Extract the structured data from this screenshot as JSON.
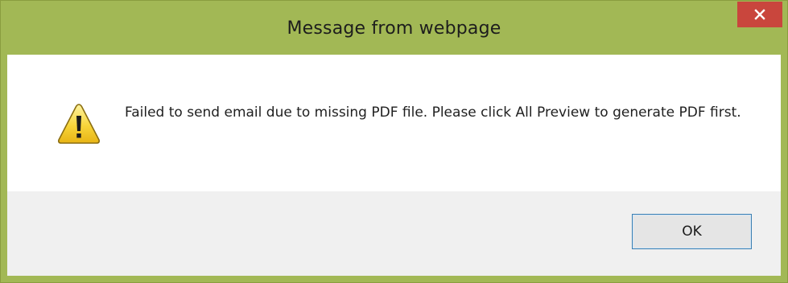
{
  "dialog": {
    "title": "Message from webpage",
    "message": "Failed to send email due to missing PDF file. Please click All Preview to generate PDF first.",
    "icon": "warning-icon",
    "ok_label": "OK",
    "close_icon": "close-icon"
  },
  "colors": {
    "frame": "#a2b855",
    "close_button": "#c9463d",
    "footer": "#f0f0f0",
    "ok_border": "#3c7fb1"
  }
}
